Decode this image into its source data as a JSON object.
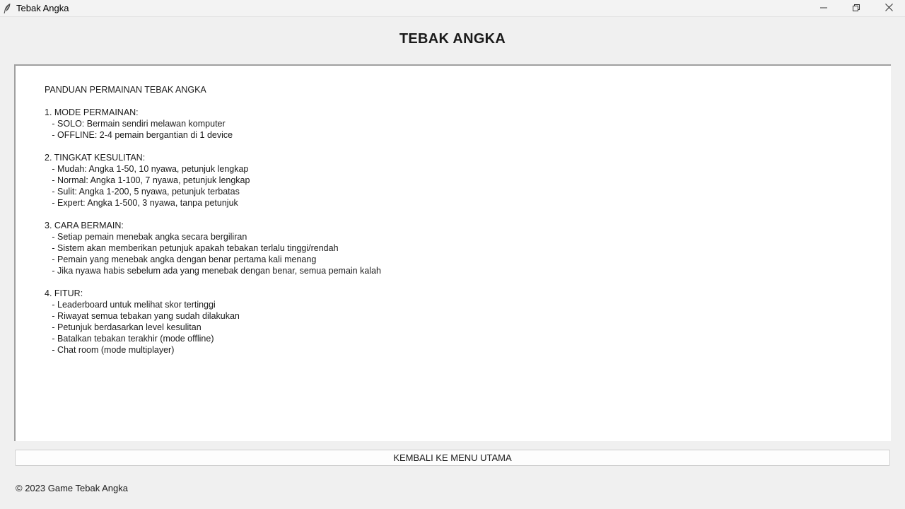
{
  "window": {
    "title": "Tebak Angka",
    "icons": {
      "app": "feather-icon",
      "minimize": "minimize-icon",
      "maximize": "restore-icon",
      "close": "close-icon"
    }
  },
  "header": {
    "title": "TEBAK ANGKA"
  },
  "guide": {
    "lines": [
      "PANDUAN PERMAINAN TEBAK ANGKA",
      "",
      "1. MODE PERMAINAN:",
      "   - SOLO: Bermain sendiri melawan komputer",
      "   - OFFLINE: 2-4 pemain bergantian di 1 device",
      "",
      "2. TINGKAT KESULITAN:",
      "   - Mudah: Angka 1-50, 10 nyawa, petunjuk lengkap",
      "   - Normal: Angka 1-100, 7 nyawa, petunjuk lengkap",
      "   - Sulit: Angka 1-200, 5 nyawa, petunjuk terbatas",
      "   - Expert: Angka 1-500, 3 nyawa, tanpa petunjuk",
      "",
      "3. CARA BERMAIN:",
      "   - Setiap pemain menebak angka secara bergiliran",
      "   - Sistem akan memberikan petunjuk apakah tebakan terlalu tinggi/rendah",
      "   - Pemain yang menebak angka dengan benar pertama kali menang",
      "   - Jika nyawa habis sebelum ada yang menebak dengan benar, semua pemain kalah",
      "",
      "4. FITUR:",
      "   - Leaderboard untuk melihat skor tertinggi",
      "   - Riwayat semua tebakan yang sudah dilakukan",
      "   - Petunjuk berdasarkan level kesulitan",
      "   - Batalkan tebakan terakhir (mode offline)",
      "   - Chat room (mode multiplayer)"
    ]
  },
  "actions": {
    "back_label": "KEMBALI KE MENU UTAMA"
  },
  "footer": {
    "copyright": "© 2023 Game Tebak Angka"
  }
}
